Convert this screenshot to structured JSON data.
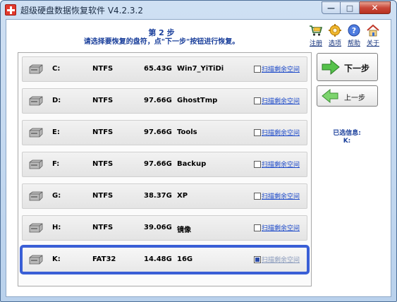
{
  "window": {
    "title": "超级硬盘数据恢复软件 V4.2.3.2",
    "controls": {
      "minimize": "—",
      "maximize": "□",
      "close": "✕"
    }
  },
  "header": {
    "step_title": "第 2 步",
    "instruction": "请选择要恢复的盘符，点\"下一步\"按钮进行恢复。"
  },
  "toolbar": [
    {
      "label": "注册",
      "icon": "cart-icon"
    },
    {
      "label": "选项",
      "icon": "gear-icon"
    },
    {
      "label": "帮助",
      "icon": "help-icon"
    },
    {
      "label": "关于",
      "icon": "home-icon"
    }
  ],
  "drives": [
    {
      "letter": "C:",
      "fs": "NTFS",
      "size": "65.43G",
      "label": "Win7_YiTiDi",
      "scan_label": "扫描剩余空间",
      "checked": false,
      "selected": false
    },
    {
      "letter": "D:",
      "fs": "NTFS",
      "size": "97.66G",
      "label": "GhostTmp",
      "scan_label": "扫描剩余空间",
      "checked": false,
      "selected": false
    },
    {
      "letter": "E:",
      "fs": "NTFS",
      "size": "97.66G",
      "label": "Tools",
      "scan_label": "扫描剩余空间",
      "checked": false,
      "selected": false
    },
    {
      "letter": "F:",
      "fs": "NTFS",
      "size": "97.66G",
      "label": "Backup",
      "scan_label": "扫描剩余空间",
      "checked": false,
      "selected": false
    },
    {
      "letter": "G:",
      "fs": "NTFS",
      "size": "38.37G",
      "label": "XP",
      "scan_label": "扫描剩余空间",
      "checked": false,
      "selected": false
    },
    {
      "letter": "H:",
      "fs": "NTFS",
      "size": "39.06G",
      "label": "镜像",
      "scan_label": "扫描剩余空间",
      "checked": false,
      "selected": false
    },
    {
      "letter": "K:",
      "fs": "FAT32",
      "size": "14.48G",
      "label": "16G",
      "scan_label": "扫描剩余空间",
      "checked": true,
      "selected": true
    }
  ],
  "buttons": {
    "next": "下一步",
    "prev": "上一步"
  },
  "selection": {
    "label": "已选信息:",
    "value": "K:"
  },
  "colors": {
    "accent": "#1a3f9b",
    "selection_outline": "#3a5fd6",
    "next_arrow": "#3aa53a",
    "prev_arrow": "#5cc25c"
  }
}
